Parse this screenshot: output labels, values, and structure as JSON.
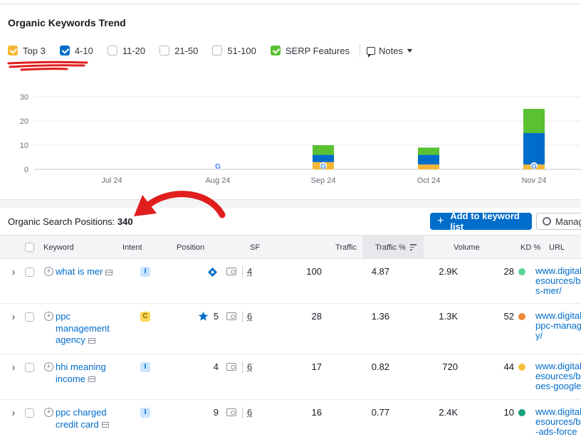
{
  "card": {
    "title": "Organic Keywords Trend"
  },
  "filters": [
    {
      "label": "Top 3",
      "checked": true,
      "color": "#f5b634"
    },
    {
      "label": "4-10",
      "checked": true,
      "color": "#006dca"
    },
    {
      "label": "11-20",
      "checked": false,
      "color": "#ffffff"
    },
    {
      "label": "21-50",
      "checked": false,
      "color": "#ffffff"
    },
    {
      "label": "51-100",
      "checked": false,
      "color": "#ffffff"
    },
    {
      "label": "SERP Features",
      "checked": true,
      "color": "#59c132"
    }
  ],
  "notes_label": "Notes",
  "chart_data": {
    "type": "bar",
    "stacked": true,
    "categories": [
      "Jul 24",
      "Aug 24",
      "Sep 24",
      "Oct 24",
      "Nov 24"
    ],
    "series": [
      {
        "name": "Top 3",
        "color": "#f5b634",
        "values": [
          0,
          0,
          3,
          2,
          2
        ]
      },
      {
        "name": "4-10",
        "color": "#006dca",
        "values": [
          0,
          0,
          3,
          4,
          13
        ]
      },
      {
        "name": "SERP Features",
        "color": "#59c132",
        "values": [
          0,
          0,
          4,
          3,
          10
        ]
      }
    ],
    "google_markers": [
      "Aug 24",
      "Sep 24",
      "Nov 24"
    ],
    "yticks": [
      0,
      10,
      20,
      30
    ],
    "ylim": [
      0,
      30
    ],
    "grid": true
  },
  "positions": {
    "label": "Organic Search Positions:",
    "count": "340"
  },
  "buttons": {
    "add_label": "Add to keyword list",
    "manage_label": "Manage"
  },
  "table": {
    "headers": {
      "keyword": "Keyword",
      "intent": "Intent",
      "position": "Position",
      "sf": "SF",
      "traffic": "Traffic",
      "traffic_pct": "Traffic %",
      "volume": "Volume",
      "kd": "KD %",
      "url": "URL"
    },
    "rows": [
      {
        "kw": "what is mer",
        "intent": "I",
        "pos_icon": "diamond",
        "position": "",
        "sf": "4",
        "traffic": "100",
        "traffic_pct": "4.87",
        "volume": "2.9K",
        "kd": "28",
        "kd_color": "#59d59a",
        "url": [
          "www.digital",
          "esources/bl",
          "s-mer/"
        ]
      },
      {
        "kw": "ppc management agency",
        "intent": "C",
        "pos_icon": "star",
        "position": "5",
        "sf": "6",
        "traffic": "28",
        "traffic_pct": "1.36",
        "volume": "1.3K",
        "kd": "52",
        "kd_color": "#f0883a",
        "url": [
          "www.digital",
          "ppc-manag",
          "y/"
        ]
      },
      {
        "kw": "hhi meaning income",
        "intent": "I",
        "pos_icon": "",
        "position": "4",
        "sf": "6",
        "traffic": "17",
        "traffic_pct": "0.82",
        "volume": "720",
        "kd": "44",
        "kd_color": "#f5c03a",
        "url": [
          "www.digital",
          "esources/bl",
          "oes-google"
        ]
      },
      {
        "kw": "ppc charged credit card",
        "intent": "I",
        "pos_icon": "",
        "position": "9",
        "sf": "6",
        "traffic": "16",
        "traffic_pct": "0.77",
        "volume": "2.4K",
        "kd": "10",
        "kd_color": "#13a07a",
        "url": [
          "www.digital",
          "esources/bl",
          "-ads-force"
        ]
      }
    ]
  }
}
